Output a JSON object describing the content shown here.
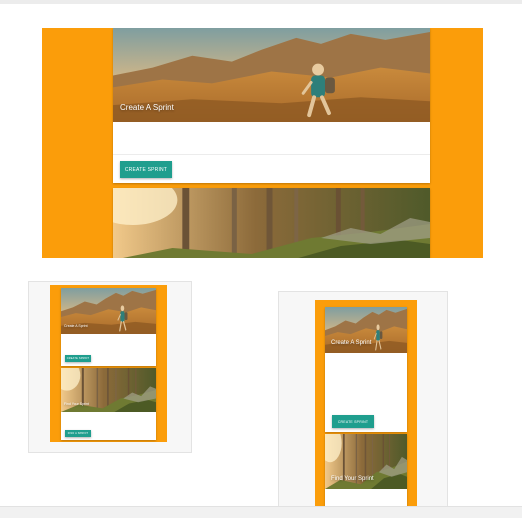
{
  "colors": {
    "frame": "#fb9d0a",
    "button": "#1f9e8e",
    "card": "#ffffff"
  },
  "cards": {
    "create": {
      "title": "Create A Sprint",
      "button_label": "CREATE SPRINT"
    },
    "second": {
      "title": "Find Your Sprint",
      "button_label": "FIND A SPRINT"
    }
  },
  "icons": [
    "hiker-photo",
    "forest-trail-photo"
  ]
}
